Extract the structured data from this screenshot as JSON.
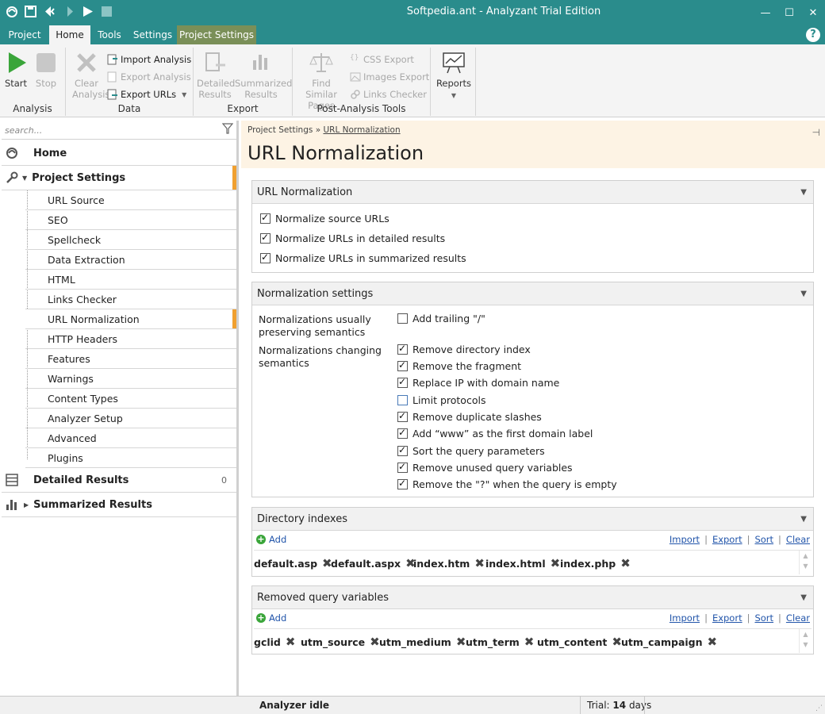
{
  "window": {
    "title": "Softpedia.ant - Analyzant Trial Edition"
  },
  "menu_tabs": [
    "Project",
    "Home",
    "Tools",
    "Settings",
    "Project Settings"
  ],
  "ribbon": {
    "analysis": {
      "label": "Analysis",
      "start": "Start",
      "stop": "Stop"
    },
    "data": {
      "label": "Data",
      "clear_1": "Clear",
      "clear_2": "Analysis",
      "import": "Import Analysis",
      "export": "Export Analysis",
      "export_urls": "Export URLs"
    },
    "export": {
      "label": "Export",
      "detailed_1": "Detailed",
      "detailed_2": "Results",
      "summarized_1": "Summarized",
      "summarized_2": "Results"
    },
    "post": {
      "label": "Post-Analysis Tools",
      "find_1": "Find Similar",
      "find_2": "Pages",
      "css": "CSS Export",
      "images": "Images Export",
      "links": "Links Checker"
    },
    "reports": {
      "label": "Reports"
    }
  },
  "left": {
    "search_placeholder": "search...",
    "home": "Home",
    "project_settings": "Project Settings",
    "sub_items": [
      "URL Source",
      "SEO",
      "Spellcheck",
      "Data Extraction",
      "HTML",
      "Links Checker",
      "URL Normalization",
      "HTTP Headers",
      "Features",
      "Warnings",
      "Content Types",
      "Analyzer Setup",
      "Advanced",
      "Plugins"
    ],
    "detailed_results": "Detailed Results",
    "detailed_count": "0",
    "summarized_results": "Summarized Results"
  },
  "content": {
    "breadcrumb_root": "Project Settings",
    "breadcrumb_sep": "»",
    "breadcrumb_current": "URL Normalization",
    "title": "URL Normalization",
    "sec1": {
      "title": "URL Normalization",
      "items": [
        {
          "label": "Normalize source URLs",
          "checked": true
        },
        {
          "label": "Normalize URLs in detailed results",
          "checked": true
        },
        {
          "label": "Normalize URLs in summarized results",
          "checked": true
        }
      ]
    },
    "sec2": {
      "title": "Normalization settings",
      "group1_label": "Normalizations usually preserving semantics",
      "group2_label": "Normalizations changing semantics",
      "group1_items": [
        {
          "label": "Add trailing \"/\"",
          "checked": false
        }
      ],
      "group2_items": [
        {
          "label": "Remove directory index",
          "checked": true
        },
        {
          "label": "Remove the fragment",
          "checked": true
        },
        {
          "label": "Replace IP with domain name",
          "checked": true
        },
        {
          "label": "Limit protocols",
          "checked": false
        },
        {
          "label": "Remove duplicate slashes",
          "checked": true
        },
        {
          "label": "Add “www” as the first domain label",
          "checked": true
        },
        {
          "label": "Sort the query parameters",
          "checked": true
        },
        {
          "label": "Remove unused query variables",
          "checked": true
        },
        {
          "label": "Remove the \"?\" when the query is empty",
          "checked": true
        }
      ]
    },
    "sec3": {
      "title": "Directory indexes",
      "add": "Add",
      "tools": [
        "Import",
        "Export",
        "Sort",
        "Clear"
      ],
      "tags": [
        "default.asp",
        "default.aspx",
        "index.htm",
        "index.html",
        "index.php"
      ]
    },
    "sec4": {
      "title": "Removed query variables",
      "add": "Add",
      "tools": [
        "Import",
        "Export",
        "Sort",
        "Clear"
      ],
      "tags": [
        "gclid",
        "utm_source",
        "utm_medium",
        "utm_term",
        "utm_content",
        "utm_campaign"
      ]
    }
  },
  "status": {
    "state": "Analyzer idle",
    "trial_prefix": "Trial:",
    "trial_days": "14",
    "trial_suffix": "days"
  },
  "colors": {
    "titlebar": "#2a8c8c",
    "context_tab": "#7a8f58",
    "accent": "#f0a030",
    "header_bg": "#fdf3e4"
  }
}
